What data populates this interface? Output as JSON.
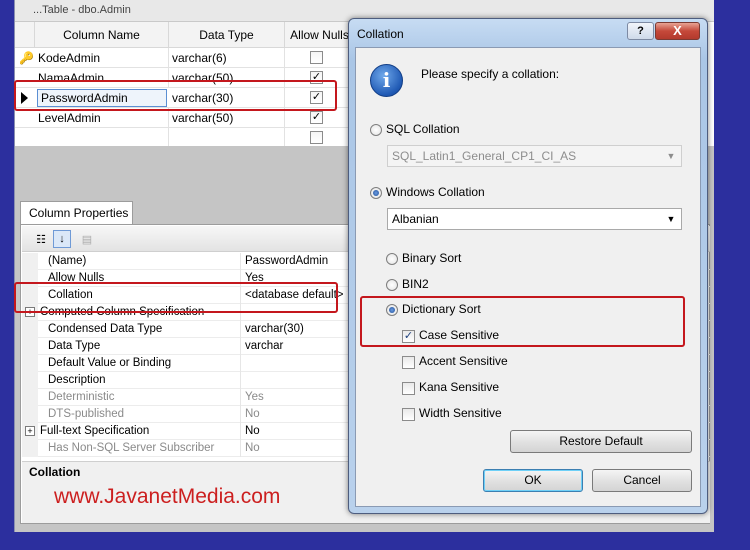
{
  "designer": {
    "tab_text": "...Table - dbo.Admin",
    "headers": {
      "column_name": "Column Name",
      "data_type": "Data Type",
      "allow_nulls": "Allow Nulls"
    },
    "rows": [
      {
        "name": "KodeAdmin",
        "type": "varchar(6)",
        "allow_nulls": false,
        "key": true,
        "current": false
      },
      {
        "name": "NamaAdmin",
        "type": "varchar(50)",
        "allow_nulls": true,
        "key": false,
        "current": false
      },
      {
        "name": "PasswordAdmin",
        "type": "varchar(30)",
        "allow_nulls": true,
        "key": false,
        "current": true
      },
      {
        "name": "LevelAdmin",
        "type": "varchar(50)",
        "allow_nulls": true,
        "key": false,
        "current": false
      },
      {
        "name": "",
        "type": "",
        "allow_nulls": false,
        "key": false,
        "current": false
      }
    ]
  },
  "column_properties": {
    "tab_label": "Column Properties",
    "rows": [
      {
        "name": "(Name)",
        "value": "PasswordAdmin",
        "dim": false,
        "expandable": false
      },
      {
        "name": "Allow Nulls",
        "value": "Yes",
        "dim": false,
        "expandable": false
      },
      {
        "name": "Collation",
        "value": "<database default>",
        "dim": false,
        "expandable": false
      },
      {
        "name": "Computed Column Specification",
        "value": "",
        "dim": false,
        "expandable": true
      },
      {
        "name": "Condensed Data Type",
        "value": "varchar(30)",
        "dim": false,
        "expandable": false
      },
      {
        "name": "Data Type",
        "value": "varchar",
        "dim": false,
        "expandable": false
      },
      {
        "name": "Default Value or Binding",
        "value": "",
        "dim": false,
        "expandable": false
      },
      {
        "name": "Description",
        "value": "",
        "dim": false,
        "expandable": false
      },
      {
        "name": "Deterministic",
        "value": "Yes",
        "dim": true,
        "expandable": false
      },
      {
        "name": "DTS-published",
        "value": "No",
        "dim": true,
        "expandable": false
      },
      {
        "name": "Full-text Specification",
        "value": "No",
        "dim": false,
        "expandable": true
      },
      {
        "name": "Has Non-SQL Server Subscriber",
        "value": "No",
        "dim": true,
        "expandable": false
      }
    ],
    "description_title": "Collation"
  },
  "watermark": "www.JavanetMedia.com",
  "dialog": {
    "title": "Collation",
    "help_label": "?",
    "close_label": "X",
    "prompt": "Please specify a collation:",
    "sql_collation_label": "SQL Collation",
    "sql_collation_value": "SQL_Latin1_General_CP1_CI_AS",
    "windows_collation_label": "Windows Collation",
    "windows_collation_value": "Albanian",
    "binary_sort_label": "Binary Sort",
    "bin2_label": "BIN2",
    "dictionary_sort_label": "Dictionary Sort",
    "case_sensitive_label": "Case Sensitive",
    "accent_sensitive_label": "Accent Sensitive",
    "kana_sensitive_label": "Kana Sensitive",
    "width_sensitive_label": "Width Sensitive",
    "restore_default_label": "Restore Default",
    "ok_label": "OK",
    "cancel_label": "Cancel",
    "selected_collation_type": "windows",
    "selected_sort": "dictionary",
    "case_sensitive": true,
    "accent_sensitive": false,
    "kana_sensitive": false,
    "width_sensitive": false
  },
  "colors": {
    "background": "#2c2f9e",
    "highlight": "#c4171d",
    "watermark": "#cc1f1f"
  }
}
